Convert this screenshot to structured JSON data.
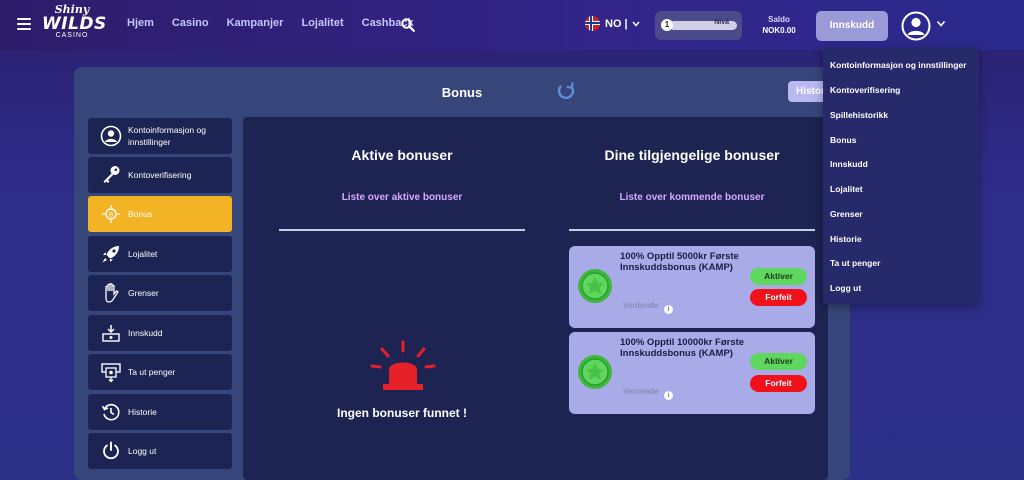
{
  "header": {
    "logo": {
      "line1": "Shiny",
      "line2": "WILDS",
      "line3": "CASINO"
    },
    "nav": [
      "Hjem",
      "Casino",
      "Kampanjer",
      "Lojalitet",
      "Cashback"
    ],
    "language": "NO |",
    "level": {
      "number": "1",
      "label": "Nivå",
      "progress_pct": 0
    },
    "balance_label": "Saldo",
    "balance_value": "NOK0.00",
    "deposit_label": "Innskudd"
  },
  "page": {
    "title": "Bonus",
    "history_button": "Historie"
  },
  "sidebar": [
    {
      "label": "Kontoinformasjon og innstillinger",
      "icon": "user-icon"
    },
    {
      "label": "Kontoverifisering",
      "icon": "key-icon"
    },
    {
      "label": "Bonus",
      "icon": "bonus-icon",
      "active": true
    },
    {
      "label": "Lojalitet",
      "icon": "rocket-icon"
    },
    {
      "label": "Grenser",
      "icon": "hand-icon"
    },
    {
      "label": "Innskudd",
      "icon": "deposit-icon"
    },
    {
      "label": "Ta ut penger",
      "icon": "withdraw-icon"
    },
    {
      "label": "Historie",
      "icon": "history-icon"
    },
    {
      "label": "Logg ut",
      "icon": "power-icon"
    }
  ],
  "active_bonuses": {
    "title": "Aktive bonuser",
    "subtitle": "Liste over aktive bonuser",
    "empty_text": "Ingen bonuser funnet !"
  },
  "available_bonuses": {
    "title": "Dine tilgjengelige bonuser",
    "subtitle": "Liste over kommende bonuser",
    "items": [
      {
        "title": "100% Opptil 5000kr Første Innskuddsbonus (KAMP)",
        "status": "Ventende",
        "activate": "Aktiver",
        "forfeit": "Forfeit"
      },
      {
        "title": "100% Opptil 10000kr Første Innskuddsbonus (KAMP)",
        "status": "Ventende",
        "activate": "Aktiver",
        "forfeit": "Forfeit"
      }
    ]
  },
  "dropdown": [
    "Kontoinformasjon og innstillinger",
    "Kontoverifisering",
    "Spillehistorikk",
    "Bonus",
    "Innskudd",
    "Lojalitet",
    "Grenser",
    "Historie",
    "Ta ut penger",
    "Logg ut"
  ],
  "colors": {
    "accent": "#f2b324",
    "activate": "#5fd75f",
    "forfeit": "#f0111a",
    "card": "#a9abe8",
    "alarm": "#e8202a"
  }
}
